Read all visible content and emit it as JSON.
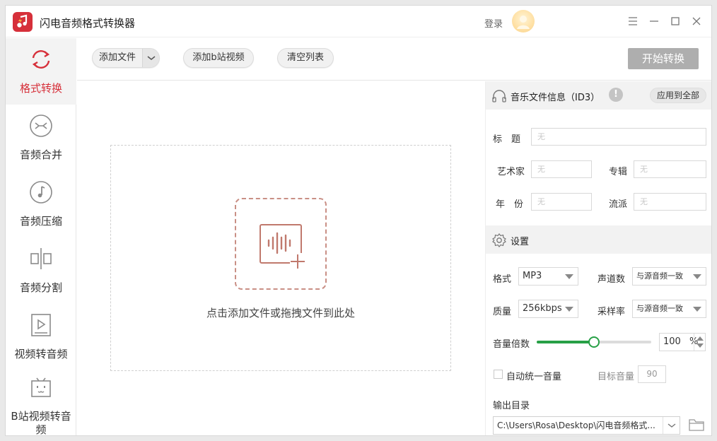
{
  "app": {
    "title": "闪电音频格式转换器",
    "login_label": "登录",
    "accent_color": "#d6303a"
  },
  "window_controls": [
    "menu-icon",
    "minimize-icon",
    "maximize-icon",
    "close-icon"
  ],
  "sidebar": {
    "items": [
      {
        "label": "格式转换",
        "icon": "convert-cycle-icon",
        "active": true
      },
      {
        "label": "音频合并",
        "icon": "merge-icon",
        "active": false
      },
      {
        "label": "音频压缩",
        "icon": "music-note-icon",
        "active": false
      },
      {
        "label": "音频分割",
        "icon": "split-icon",
        "active": false
      },
      {
        "label": "视频转音频",
        "icon": "video-play-icon",
        "active": false
      },
      {
        "label": "B站视频转音频",
        "icon": "bilibili-tv-icon",
        "active": false
      }
    ]
  },
  "toolbar": {
    "add_file": "添加文件",
    "add_bilibili": "添加b站视频",
    "clear_list": "清空列表",
    "start_convert": "开始转换"
  },
  "dropzone": {
    "hint": "点击添加文件或拖拽文件到此处"
  },
  "id3": {
    "header": "音乐文件信息（ID3）",
    "apply_all": "应用到全部",
    "fields": {
      "title_label": "标　题",
      "artist_label": "艺术家",
      "album_label": "专辑",
      "year_label": "年　份",
      "genre_label": "流派",
      "placeholder": "无"
    }
  },
  "settings": {
    "header": "设置",
    "format_label": "格式",
    "format_value": "MP3",
    "channels_label": "声道数",
    "channels_value": "与源音频一致",
    "quality_label": "质量",
    "quality_value": "256kbps",
    "samplerate_label": "采样率",
    "samplerate_value": "与源音频一致",
    "volume_label": "音量倍数",
    "volume_value": "100",
    "volume_unit": "%",
    "volume_fraction": 0.5,
    "auto_volume_label": "自动统一音量",
    "auto_volume_checked": false,
    "target_volume_label": "目标音量",
    "target_volume_value": "90",
    "output_label": "输出目录",
    "output_path": "C:\\Users\\Rosa\\Desktop\\闪电音频格式..."
  }
}
